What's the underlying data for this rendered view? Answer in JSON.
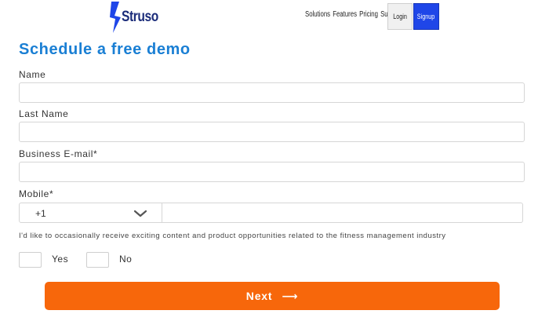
{
  "header": {
    "brand": "Struso",
    "nav": [
      "Solutions",
      "Features",
      "Pricing",
      "Support"
    ],
    "login_label": "Login",
    "signup_label": "Signup"
  },
  "form": {
    "title": "Schedule a free demo",
    "fields": {
      "name_label": "Name",
      "last_name_label": "Last Name",
      "email_label": "Business E-mail*",
      "mobile_label": "Mobile*",
      "country_code": "+1"
    },
    "consent_text": "I'd like to occasionally receive exciting content and product opportunities related to the fitness management industry",
    "yes_label": "Yes",
    "no_label": "No",
    "next_label": "Next",
    "next_arrow": "⟶"
  },
  "colors": {
    "title": "#1a7fd4",
    "cta": "#f7670b",
    "signup": "#1f46e8",
    "brand": "#1b2c7a"
  }
}
